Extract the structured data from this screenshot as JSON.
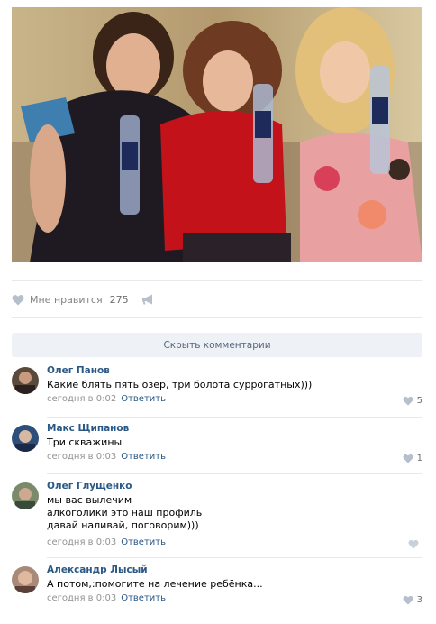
{
  "post": {
    "photo_alt": "",
    "likes_label": "Мне нравится",
    "likes_count": "275"
  },
  "comments_toggle": "Скрыть комментарии",
  "comments": [
    {
      "author": "Олег Панов",
      "text": "Какие блять пять озёр, три болота суррогатных)))",
      "time": "сегодня в 0:02",
      "reply": "Ответить",
      "likes": "5",
      "avatar_color": "#5a4a3c"
    },
    {
      "author": "Макс Щипанов",
      "text": "Три скважины",
      "time": "сегодня в 0:03",
      "reply": "Ответить",
      "likes": "1",
      "avatar_color": "#2e4f7a"
    },
    {
      "author": "Олег Глущенко",
      "text": "мы вас вылечим\nалкоголики это наш профиль\nдавай наливай, поговорим)))",
      "time": "сегодня в 0:03",
      "reply": "Ответить",
      "likes": "",
      "avatar_color": "#7a8a6a"
    },
    {
      "author": "Александр Лысый",
      "text": "А потом,:помогите на лечение ребёнка...",
      "time": "сегодня в 0:03",
      "reply": "Ответить",
      "likes": "3",
      "avatar_color": "#a88a78"
    }
  ],
  "colors": {
    "link": "#2a5885",
    "muted": "#939393",
    "button_bg": "#eef1f5",
    "icon": "#b5c0cc"
  },
  "icons": {
    "like": "heart-icon",
    "share": "megaphone-icon",
    "comment_like": "heart-icon"
  }
}
